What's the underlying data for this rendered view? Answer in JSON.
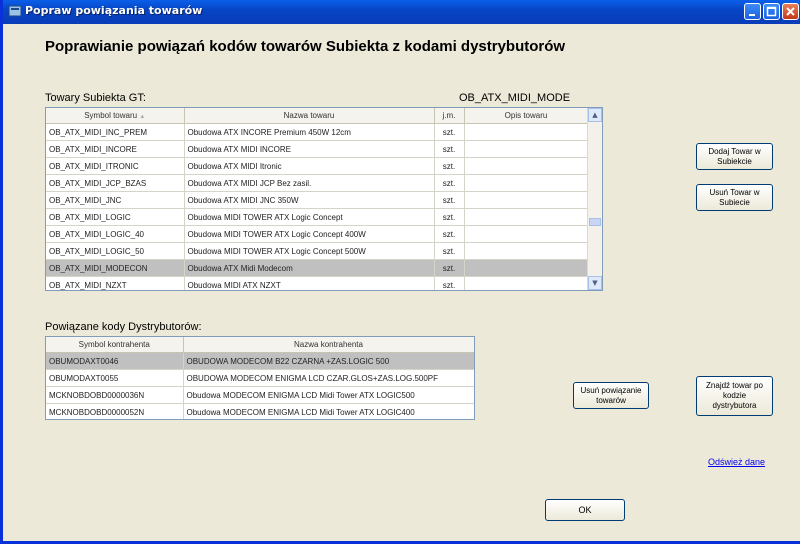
{
  "window": {
    "title": "Popraw powiązania towarów"
  },
  "heading": "Poprawianie powiązań kodów towarów Subiekta z kodami dystrybutorów",
  "products": {
    "label": "Towary Subiekta GT:",
    "current": "OB_ATX_MIDI_MODE",
    "columns": [
      "Symbol towaru",
      "Nazwa towaru",
      "j.m.",
      "Opis towaru"
    ],
    "rows": [
      {
        "symbol": "OB_ATX_MIDI_INC_PREM",
        "name": "Obudowa ATX INCORE Premium 450W 12cm",
        "unit": "szt.",
        "desc": ""
      },
      {
        "symbol": "OB_ATX_MIDI_INCORE",
        "name": "Obudowa ATX MIDI INCORE",
        "unit": "szt.",
        "desc": ""
      },
      {
        "symbol": "OB_ATX_MIDI_ITRONIC",
        "name": "Obudowa ATX MIDI Itronic",
        "unit": "szt.",
        "desc": ""
      },
      {
        "symbol": "OB_ATX_MIDI_JCP_BZAS",
        "name": "Obudowa ATX MIDI JCP Bez zasil.",
        "unit": "szt.",
        "desc": ""
      },
      {
        "symbol": "OB_ATX_MIDI_JNC",
        "name": "Obudowa ATX MIDI JNC 350W",
        "unit": "szt.",
        "desc": ""
      },
      {
        "symbol": "OB_ATX_MIDI_LOGIC",
        "name": "Obudowa MIDI TOWER ATX Logic Concept",
        "unit": "szt.",
        "desc": ""
      },
      {
        "symbol": "OB_ATX_MIDI_LOGIC_40",
        "name": "Obudowa MIDI TOWER ATX Logic Concept 400W",
        "unit": "szt.",
        "desc": ""
      },
      {
        "symbol": "OB_ATX_MIDI_LOGIC_50",
        "name": "Obudowa MIDI TOWER ATX Logic Concept 500W",
        "unit": "szt.",
        "desc": ""
      },
      {
        "symbol": "OB_ATX_MIDI_MODECON",
        "name": "Obudowa ATX Midi Modecom",
        "unit": "szt.",
        "desc": ""
      },
      {
        "symbol": "OB_ATX_MIDI_NZXT",
        "name": "Obudowa MIDI ATX NZXT",
        "unit": "szt.",
        "desc": ""
      }
    ],
    "selected_index": 8
  },
  "distributors": {
    "label": "Powiązane kody Dystrybutorów:",
    "columns": [
      "Symbol kontrahenta",
      "Nazwa kontrahenta"
    ],
    "rows": [
      {
        "symbol": "OBUMODAXT0046",
        "name": "OBUDOWA MODECOM B22 CZARNA +ZAS.LOGIC 500"
      },
      {
        "symbol": "OBUMODAXT0055",
        "name": "OBUDOWA MODECOM ENIGMA LCD CZAR.GLOS+ZAS.LOG.500PF"
      },
      {
        "symbol": "MCKNOBDOBD0000036N",
        "name": "Obudowa MODECOM ENIGMA LCD Midi Tower ATX LOGIC500"
      },
      {
        "symbol": "MCKNOBDOBD0000052N",
        "name": "Obudowa MODECOM ENIGMA LCD Midi Tower ATX LOGIC400"
      }
    ],
    "selected_index": 0
  },
  "buttons": {
    "add_product": "Dodaj Towar w Subiekcie",
    "remove_product": "Usuń Towar w Subiecie",
    "remove_link": "Usuń powiązanie towarów",
    "find_by_code": "Znajdź towar po kodzie dystrybutora",
    "refresh": "Odśwież dane",
    "ok": "OK"
  },
  "colors": {
    "titlebar": "#0a5fe8",
    "selection": "#c0c0c0",
    "window_bg": "#ece9d8",
    "link": "#0000ee"
  }
}
